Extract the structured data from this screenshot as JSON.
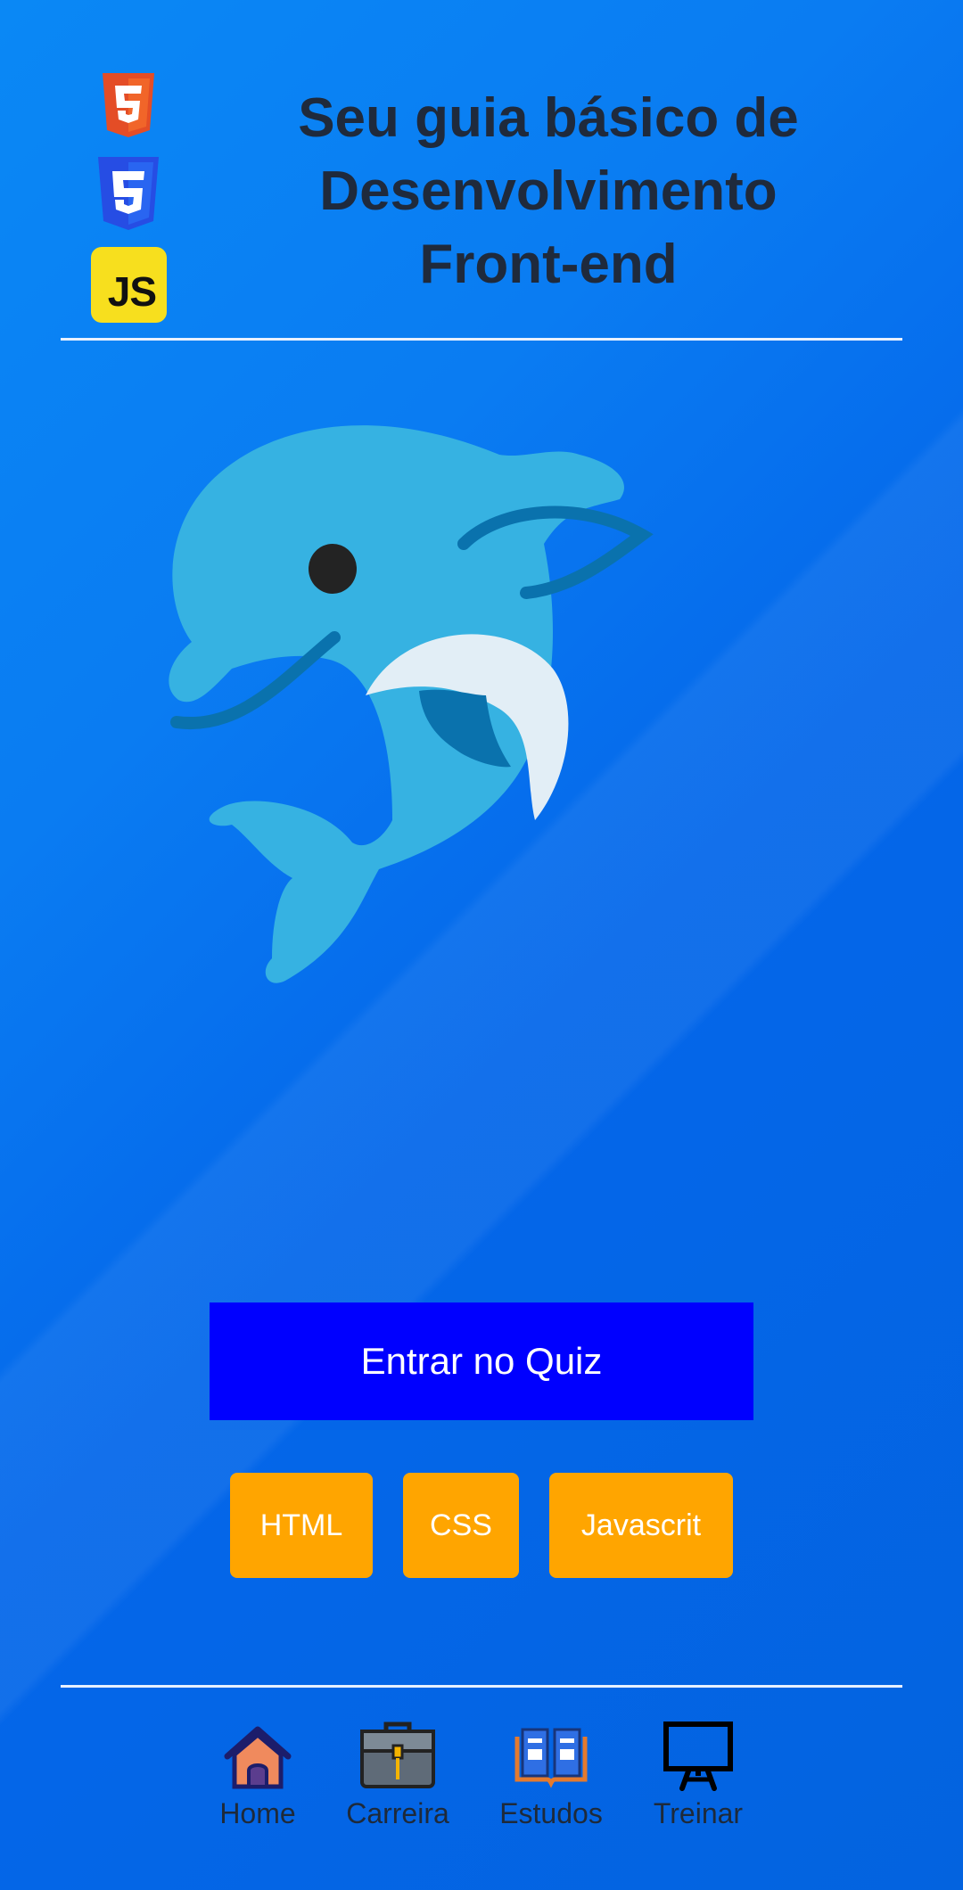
{
  "header": {
    "title_line1": "Seu guia básico de",
    "title_line2": "Desenvolvimento",
    "title_line3": "Front-end",
    "logos": {
      "html": "html5-logo",
      "css": "css3-logo",
      "js_text": "JS"
    }
  },
  "hero": {
    "image": "dolphin-illustration"
  },
  "actions": {
    "quiz_label": "Entrar no Quiz",
    "topics": [
      "HTML",
      "CSS",
      "Javascrit"
    ]
  },
  "bottom_nav": {
    "items": [
      {
        "label": "Home",
        "icon": "home-icon"
      },
      {
        "label": "Carreira",
        "icon": "briefcase-icon"
      },
      {
        "label": "Estudos",
        "icon": "book-icon"
      },
      {
        "label": "Treinar",
        "icon": "whiteboard-icon"
      }
    ]
  },
  "colors": {
    "background": "#0670ec",
    "quiz_button": "#0000ff",
    "topic_button": "#ffa500",
    "title_text": "#1f2a3c"
  }
}
